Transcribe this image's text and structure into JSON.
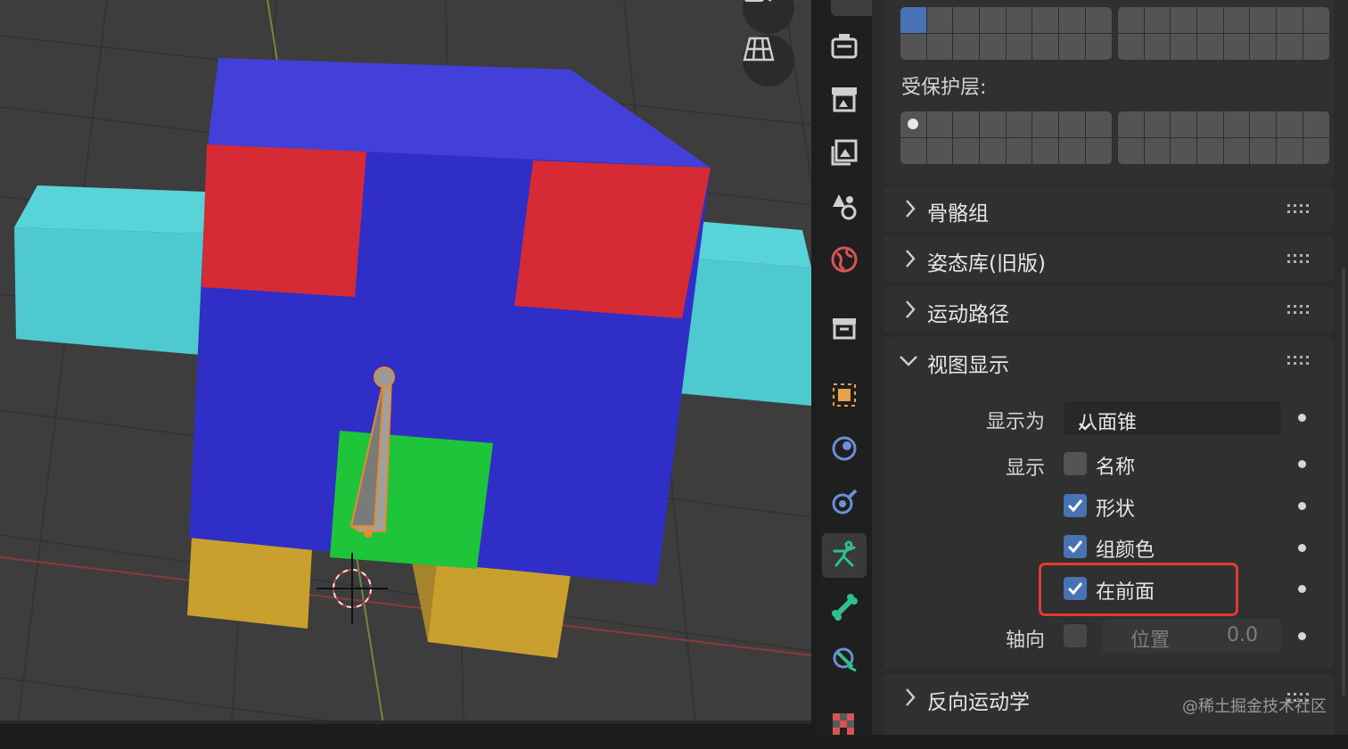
{
  "viewport": {
    "tools": [
      {
        "icon": "camera-icon"
      },
      {
        "icon": "grid-view-icon"
      }
    ]
  },
  "property_tabs": [
    {
      "icon": "tool-icon"
    },
    {
      "icon": "render-icon"
    },
    {
      "icon": "output-icon"
    },
    {
      "icon": "view-layer-icon"
    },
    {
      "icon": "scene-icon"
    },
    {
      "icon": "world-icon"
    },
    {
      "icon": "collection-icon"
    },
    {
      "icon": "object-icon"
    },
    {
      "icon": "modifier-icon"
    },
    {
      "icon": "physics-icon"
    },
    {
      "icon": "object-data-armature-icon",
      "active": true
    },
    {
      "icon": "bone-icon"
    },
    {
      "icon": "bone-constraint-icon"
    },
    {
      "icon": "texture-icon"
    }
  ],
  "skeleton": {
    "protected_layers_label": "受保护层:"
  },
  "panels": {
    "bone_groups": "骨骼组",
    "pose_library": "姿态库(旧版)",
    "motion_paths": "运动路径",
    "viewport_display": "视图显示",
    "inverse_kinematics": "反向运动学"
  },
  "viewport_display": {
    "display_as_label": "显示为",
    "display_as_value": "八面锥",
    "show_label": "显示",
    "options": [
      {
        "label": "名称",
        "checked": false
      },
      {
        "label": "形状",
        "checked": true
      },
      {
        "label": "组颜色",
        "checked": true
      },
      {
        "label": "在前面",
        "checked": true
      }
    ],
    "axes_label": "轴向",
    "axes_checked": false,
    "position_label": "位置",
    "position_value": "0.0"
  },
  "watermark": "@稀土掘金技术社区",
  "colors": {
    "accent": "#4772b3",
    "highlight": "#e23b36",
    "active_tab_icon": "#2ec28a"
  }
}
